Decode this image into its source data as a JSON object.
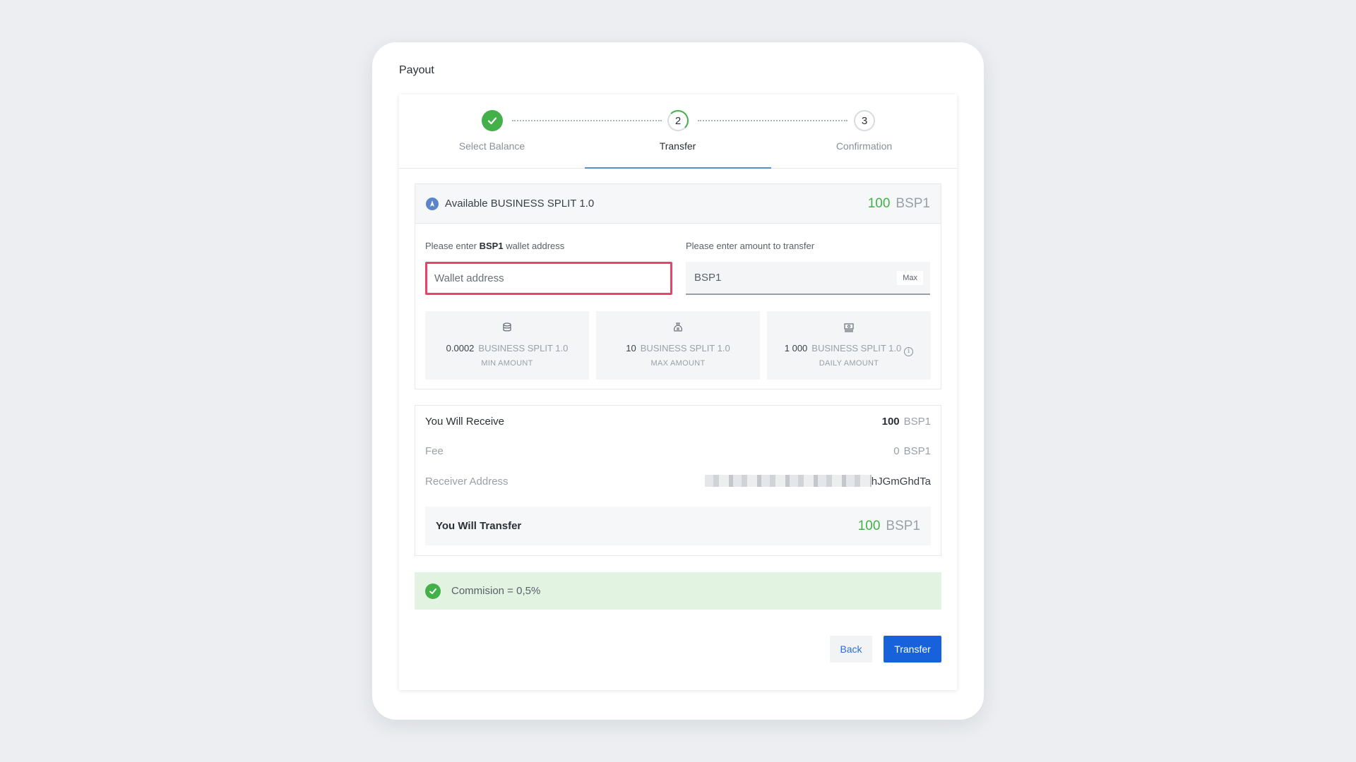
{
  "page": {
    "title": "Payout"
  },
  "stepper": {
    "steps": [
      {
        "label": "Select Balance",
        "number": "1",
        "state": "done"
      },
      {
        "label": "Transfer",
        "number": "2",
        "state": "active"
      },
      {
        "label": "Confirmation",
        "number": "3",
        "state": "pending"
      }
    ]
  },
  "balance": {
    "title": "Available BUSINESS SPLIT 1.0",
    "amount": "100",
    "unit": "BSP1",
    "icon": "coin-icon"
  },
  "form": {
    "wallet_label_prefix": "Please enter ",
    "wallet_label_bold": "BSP1",
    "wallet_label_suffix": " wallet address",
    "wallet_placeholder": "Wallet address",
    "amount_label": "Please enter amount to transfer",
    "amount_placeholder": "BSP1",
    "max_label": "Max"
  },
  "limits": [
    {
      "value": "0.0002",
      "currency": "BUSINESS SPLIT 1.0",
      "caption": "MIN AMOUNT",
      "icon": "database-icon"
    },
    {
      "value": "10",
      "currency": "BUSINESS SPLIT 1.0",
      "caption": "MAX AMOUNT",
      "icon": "money-bag-icon"
    },
    {
      "value": "1 000",
      "currency": "BUSINESS SPLIT 1.0",
      "caption": "DAILY AMOUNT",
      "icon": "cash-stack-icon",
      "info_icon": "info-icon"
    }
  ],
  "summary": {
    "receive_label": "You Will Receive",
    "receive_amount": "100",
    "receive_unit": "BSP1",
    "fee_label": "Fee",
    "fee_amount": "0",
    "fee_unit": "BSP1",
    "address_label": "Receiver Address",
    "address_tail": "hJGmGhdTa",
    "transfer_label": "You Will Transfer",
    "transfer_amount": "100",
    "transfer_unit": "BSP1"
  },
  "commission": {
    "text": "Commision = 0,5%"
  },
  "actions": {
    "back_label": "Back",
    "transfer_label": "Transfer"
  },
  "colors": {
    "accent_green": "#43b049",
    "primary_blue": "#1762db",
    "error_red": "#e8436b",
    "commission_bg": "#e2f3e2"
  }
}
